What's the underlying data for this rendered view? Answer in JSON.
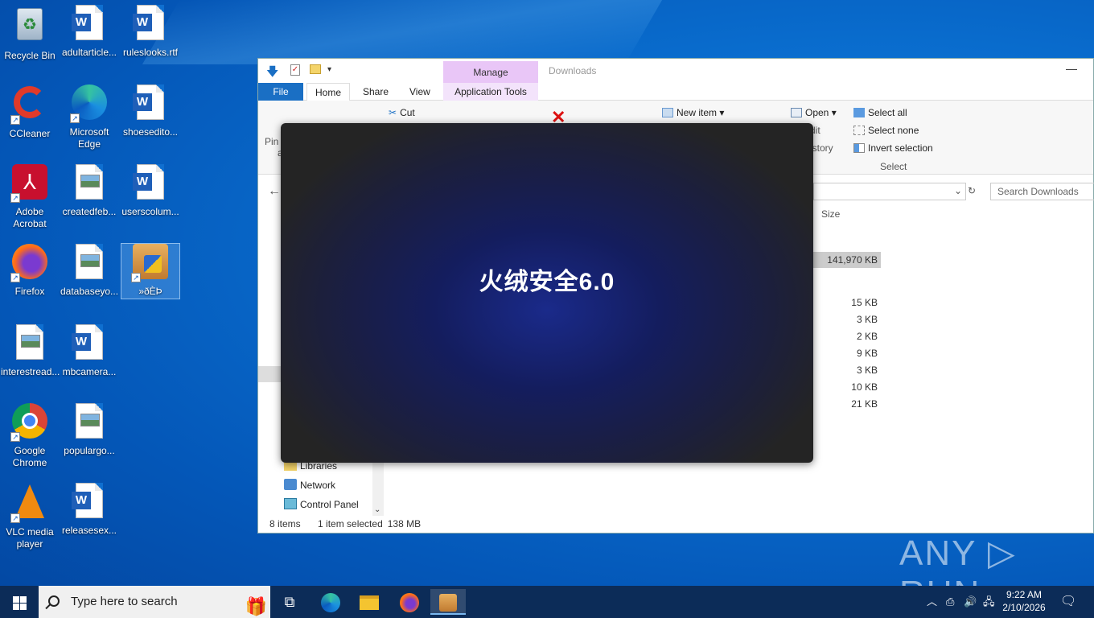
{
  "desktop": {
    "icons": [
      {
        "label": "Recycle Bin"
      },
      {
        "label": "adultarticle..."
      },
      {
        "label": "ruleslooks.rtf"
      },
      {
        "label": "CCleaner"
      },
      {
        "label": "Microsoft Edge"
      },
      {
        "label": "shoesedito..."
      },
      {
        "label": "Adobe Acrobat"
      },
      {
        "label": "createdfeb..."
      },
      {
        "label": "userscolum..."
      },
      {
        "label": "Firefox"
      },
      {
        "label": "databaseyo..."
      },
      {
        "label": "»ðÈÞ"
      },
      {
        "label": "interestread..."
      },
      {
        "label": "mbcamera..."
      },
      {
        "label": "Google Chrome"
      },
      {
        "label": "populargo..."
      },
      {
        "label": "VLC media player"
      },
      {
        "label": "releasesex..."
      }
    ]
  },
  "explorer": {
    "title": "Downloads",
    "contextual_tab": "Manage",
    "tabs": {
      "file": "File",
      "home": "Home",
      "share": "Share",
      "view": "View",
      "app_tools": "Application Tools"
    },
    "ribbon": {
      "pin": "Pin",
      "pin2": "a",
      "cut": "Cut",
      "new_item": "New item",
      "open": "Open",
      "edit": "dit",
      "history": "istory",
      "select_all": "Select all",
      "select_none": "Select none",
      "invert_selection": "Invert selection",
      "select_group": "Select"
    },
    "search_placeholder": "Search Downloads",
    "column_size": "Size",
    "selected_size": "141,970 KB",
    "sizes": [
      "15 KB",
      "3 KB",
      "2 KB",
      "9 KB",
      "3 KB",
      "10 KB",
      "21 KB"
    ],
    "nav": {
      "libraries": "Libraries",
      "network": "Network",
      "control_panel": "Control Panel"
    },
    "status": {
      "items": "8 items",
      "selected": "1 item selected",
      "size": "138 MB"
    }
  },
  "splash": {
    "title": "火绒安全6.0"
  },
  "watermark": "ANY ▷ RUN",
  "taskbar": {
    "search_placeholder": "Type here to search",
    "time": "9:22 AM",
    "date": "2/10/2026"
  },
  "colors": {
    "desktop_blue": "#0a6fd0",
    "taskbar": "#0c2c58",
    "file_tab": "#1a6fc4",
    "manage_tab": "#e9c6f7"
  }
}
